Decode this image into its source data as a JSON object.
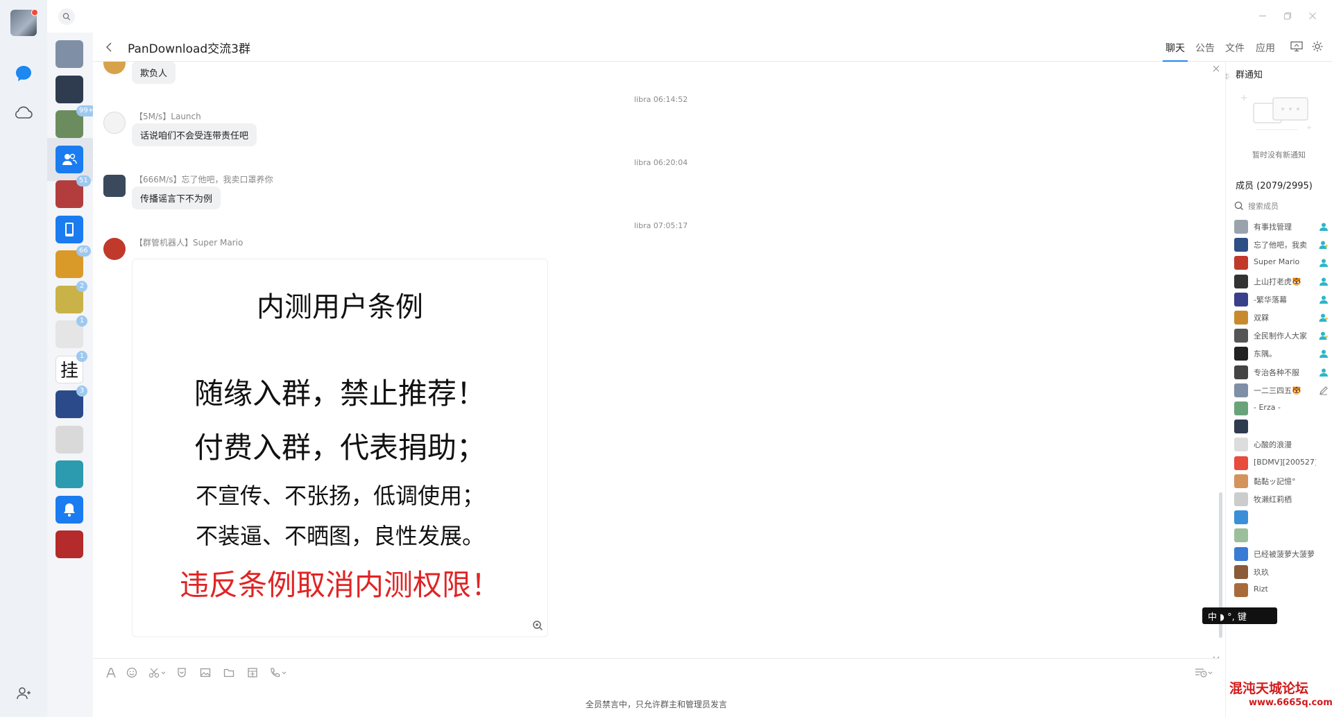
{
  "rail": {
    "icons": [
      "avatar-icon",
      "chat-bubble-icon",
      "cloud-icon",
      "contacts-icon"
    ]
  },
  "topbar": {
    "check_count": "0"
  },
  "conversations": [
    {
      "badge": "",
      "active": false,
      "color": "#7f8fa6"
    },
    {
      "badge": "",
      "active": false,
      "color": "#2f3b4f"
    },
    {
      "badge": "99+",
      "active": false,
      "color": "#6b8c5f"
    },
    {
      "badge": "",
      "active": true,
      "color": "#1a7cf0",
      "icon": "group-icon"
    },
    {
      "badge": "51",
      "active": false,
      "color": "#b33d3d"
    },
    {
      "badge": "",
      "active": false,
      "color": "#1a7cf0",
      "icon": "phone-icon"
    },
    {
      "badge": "66",
      "active": false,
      "color": "#d99a2a"
    },
    {
      "badge": "2",
      "active": false,
      "color": "#c9b248"
    },
    {
      "badge": "1",
      "active": false,
      "color": "#e5e5e5"
    },
    {
      "badge": "1",
      "active": false,
      "color": "#ffffff",
      "glyph": "挂"
    },
    {
      "badge": "3",
      "active": false,
      "color": "#2b4a8a"
    },
    {
      "badge": "",
      "active": false,
      "color": "#d9d9d9"
    },
    {
      "badge": "",
      "active": false,
      "color": "#2c9bb0"
    },
    {
      "badge": "",
      "active": false,
      "color": "#1a7cf0",
      "icon": "bell-icon"
    },
    {
      "badge": "",
      "active": false,
      "color": "#b52a2a"
    }
  ],
  "header": {
    "title": "PanDownload交流3群",
    "tabs": [
      {
        "label": "聊天",
        "active": true
      },
      {
        "label": "公告",
        "active": false
      },
      {
        "label": "文件",
        "active": false
      },
      {
        "label": "应用",
        "active": false
      }
    ]
  },
  "messages": {
    "m0_text": "欺负人",
    "t1": "libra 06:14:52",
    "m1_sender": "【5M/s】Launch",
    "m1_text": "话说咱们不会受连带责任吧",
    "t2": "libra 06:20:04",
    "m2_sender": "【666M/s】忘了他吧，我卖口罩养你",
    "m2_text": "传播谣言下不为例",
    "t3": "libra 07:05:17",
    "m3_sender": "【群管机器人】Super Mario"
  },
  "rules_image": {
    "title": "内测用户条例",
    "line1": "随缘入群，禁止推荐！",
    "line2": "付费入群，代表捐助；",
    "line3": "不宣传、不张扬，低调使用；",
    "line4": "不装逼、不晒图，良性发展。",
    "warning": "违反条例取消内测权限！",
    "warning_color": "#e02424"
  },
  "composer": {
    "mute_note": "全员禁言中，只允许群主和管理员发言"
  },
  "right_panel": {
    "notice_title": "群通知",
    "notice_empty": "暂时没有新通知",
    "members_label": "成员 (2079/2995)",
    "search_placeholder": "搜索成员",
    "members": [
      {
        "name": "有事找管理",
        "role": "admin",
        "color": "#9aa3ad"
      },
      {
        "name": "忘了他吧，我卖",
        "role": "admin-star",
        "color": "#2d4f86"
      },
      {
        "name": "Super Mario",
        "role": "admin",
        "color": "#c0392b"
      },
      {
        "name": "上山打老虎🐯",
        "role": "admin",
        "color": "#333333"
      },
      {
        "name": "-繁华落幕",
        "role": "admin",
        "color": "#3a3f8a"
      },
      {
        "name": "双槑",
        "role": "admin-star",
        "color": "#c98a2f"
      },
      {
        "name": "全民制作人大家",
        "role": "admin-star",
        "color": "#555555"
      },
      {
        "name": "东隅。",
        "role": "admin",
        "color": "#222222"
      },
      {
        "name": "专治各种不服",
        "role": "admin",
        "color": "#444444"
      },
      {
        "name": "一二三四五🐯",
        "role": "edit",
        "color": "#7f8fa6"
      },
      {
        "name": "- Erza -",
        "role": "",
        "color": "#6aa37a"
      },
      {
        "name": "",
        "role": "",
        "color": "#2f3b4f"
      },
      {
        "name": "心酸的浪漫",
        "role": "",
        "color": "#dddddd"
      },
      {
        "name": "[BDMV][200527] V",
        "role": "",
        "color": "#e74c3c"
      },
      {
        "name": "黏黏ッ記憶°",
        "role": "",
        "color": "#d3935b"
      },
      {
        "name": "牧濑红莉栖",
        "role": "",
        "color": "#cccccc"
      },
      {
        "name": "",
        "role": "",
        "color": "#3b8fd9"
      },
      {
        "name": "",
        "role": "",
        "color": "#9bbf9b"
      },
      {
        "name": "已经被菠萝大菠萝",
        "role": "",
        "color": "#3a7bd5"
      },
      {
        "name": "玖玖",
        "role": "",
        "color": "#8a5a3a"
      },
      {
        "name": "Rizt",
        "role": "",
        "color": "#a86a3a"
      }
    ]
  },
  "overlay": {
    "ime": "中 ◗ °, 键",
    "watermark_line1": "混沌天城论坛",
    "watermark_line2": "www.6665q.com"
  }
}
